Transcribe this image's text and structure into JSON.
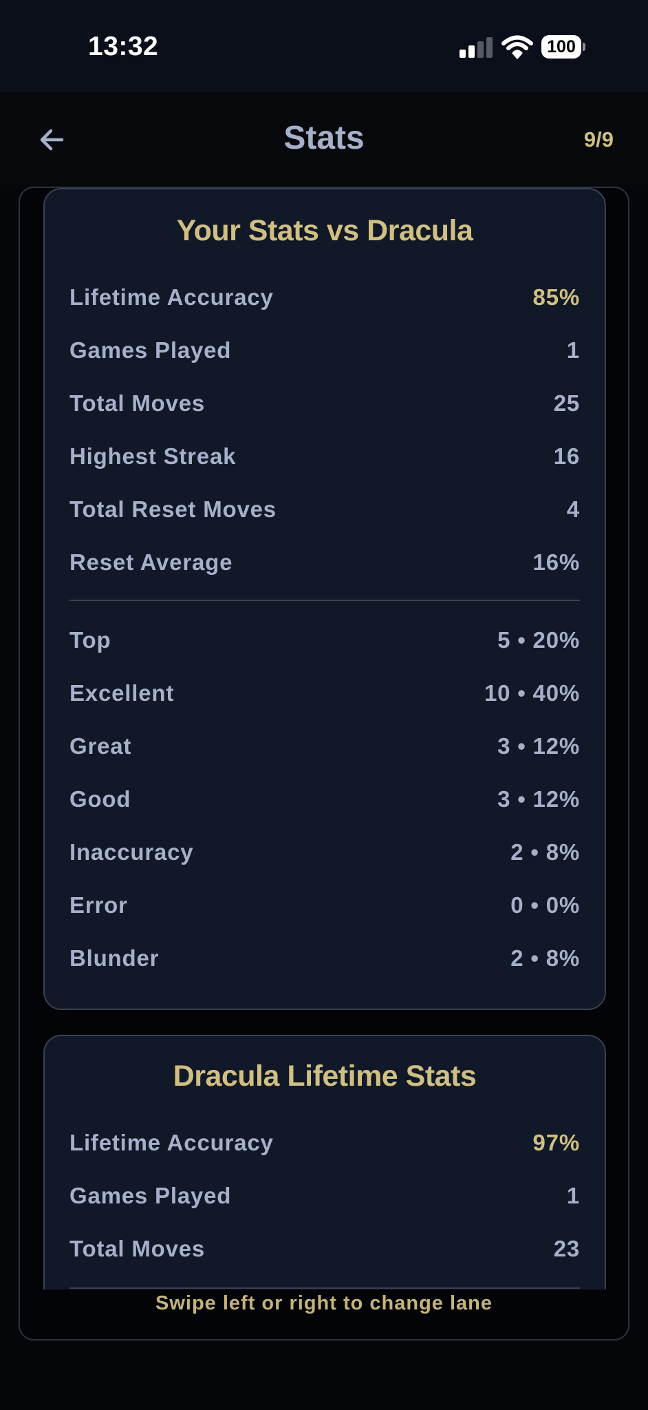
{
  "status_bar": {
    "time": "13:32",
    "battery": "100"
  },
  "header": {
    "title": "Stats",
    "counter": "9/9"
  },
  "colors": {
    "accent": "#d0bf83",
    "text": "#a5b1c9",
    "card_bg": "#111827",
    "page_bg": "#050609"
  },
  "player_card": {
    "title": "Your Stats vs Dracula",
    "summary": [
      {
        "label": "Lifetime Accuracy",
        "value": "85%"
      },
      {
        "label": "Games Played",
        "value": "1"
      },
      {
        "label": "Total Moves",
        "value": "25"
      },
      {
        "label": "Highest Streak",
        "value": "16"
      },
      {
        "label": "Total Reset Moves",
        "value": "4"
      },
      {
        "label": "Reset Average",
        "value": "16%"
      }
    ],
    "breakdown": [
      {
        "label": "Top",
        "value": "5 • 20%"
      },
      {
        "label": "Excellent",
        "value": "10 • 40%"
      },
      {
        "label": "Great",
        "value": "3 • 12%"
      },
      {
        "label": "Good",
        "value": "3 • 12%"
      },
      {
        "label": "Inaccuracy",
        "value": "2 • 8%"
      },
      {
        "label": "Error",
        "value": "0 • 0%"
      },
      {
        "label": "Blunder",
        "value": "2 • 8%"
      }
    ]
  },
  "opponent_card": {
    "title": "Dracula Lifetime Stats",
    "summary": [
      {
        "label": "Lifetime Accuracy",
        "value": "97%"
      },
      {
        "label": "Games Played",
        "value": "1"
      },
      {
        "label": "Total Moves",
        "value": "23"
      }
    ]
  },
  "footer": {
    "hint": "Swipe left or right to change lane"
  }
}
